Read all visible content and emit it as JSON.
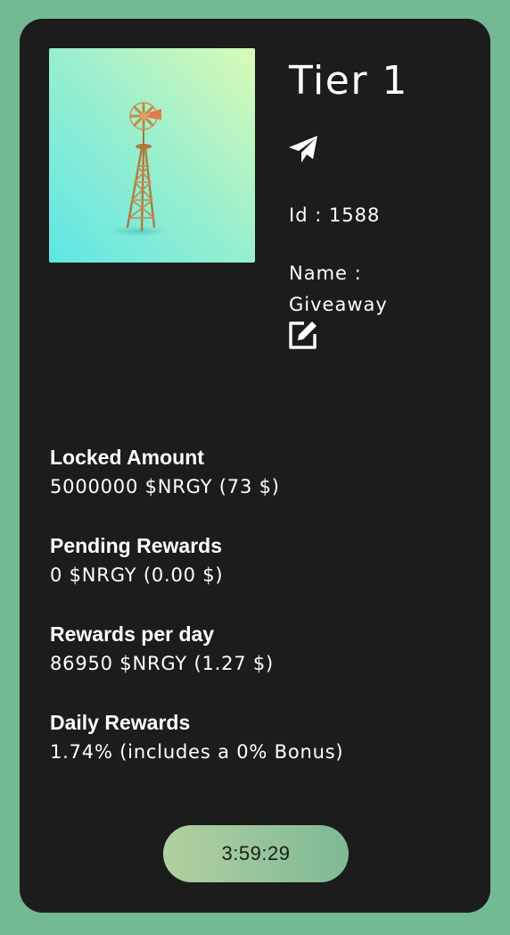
{
  "card": {
    "image_alt": "windmill-artwork",
    "tier": "Tier 1",
    "id_line": "Id : 1588",
    "name_label": "Name :",
    "name_value": "Giveaway",
    "icons": {
      "send": "paper-plane-icon",
      "edit": "edit-icon"
    }
  },
  "stats": [
    {
      "label": "Locked Amount",
      "value": "5000000 $NRGY (73 $)"
    },
    {
      "label": "Pending Rewards",
      "value": "0 $NRGY (0.00 $)"
    },
    {
      "label": "Rewards per day",
      "value": "86950 $NRGY (1.27 $)"
    },
    {
      "label": "Daily Rewards",
      "value": "1.74% (includes a 0% Bonus)"
    }
  ],
  "timer": "3:59:29",
  "colors": {
    "page_background": "#72b994",
    "card_background": "#1c1c1c",
    "text": "#ffffff",
    "button_gradient_start": "#b2d09f",
    "button_gradient_end": "#7db996"
  }
}
